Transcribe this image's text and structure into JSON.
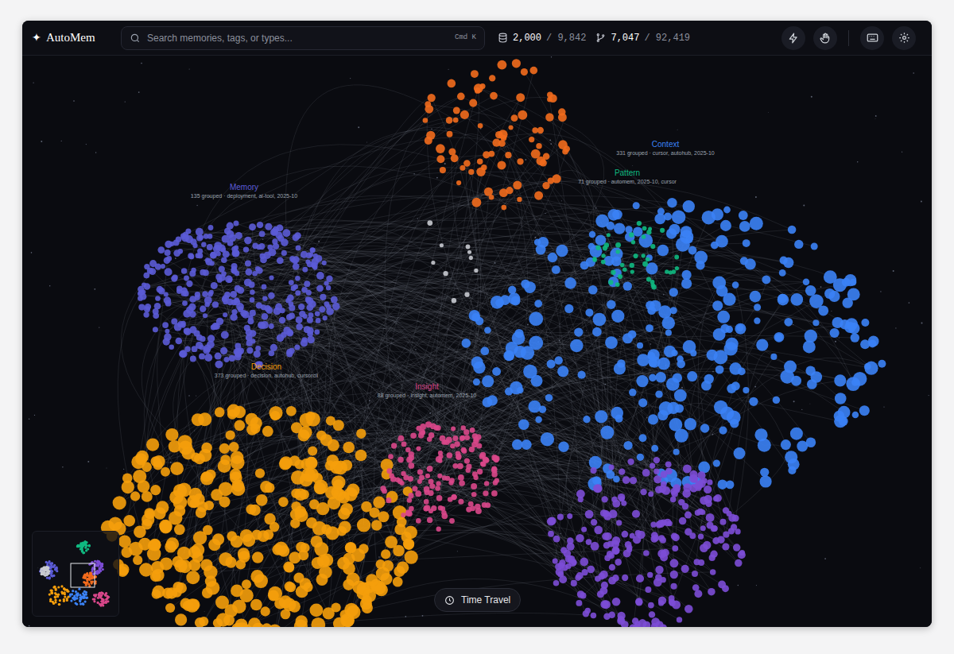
{
  "app": {
    "logo_icon": "✦",
    "name": "AutoMem"
  },
  "search": {
    "placeholder": "Search memories, tags, or types...",
    "shortcut": "Cmd K"
  },
  "stats": [
    {
      "value": "2,000",
      "total": "/ 9,842"
    },
    {
      "value": "7,047",
      "total": "/ 92,419"
    }
  ],
  "clusters": [
    {
      "color": "#f26b1d"
    },
    {
      "color": "#5b5bd6",
      "label": "Memory",
      "detail": "135 grouped · deployment, ai-tool, 2025-10"
    },
    {
      "color": "#3b82f6",
      "label": "Context",
      "detail": "331 grouped · cursor, autohub, 2025-10"
    },
    {
      "color": "#10b981",
      "label": "Pattern",
      "detail": "71 grouped · automem, 2025-10, cursor"
    },
    {
      "color": "#f59e0b",
      "label": "Decision",
      "detail": "373 grouped · decision, autohub, cursorcli"
    },
    {
      "color": "#d9478a",
      "label": "Insight",
      "detail": "88 grouped · insight, automem, 2025-10"
    },
    {
      "color": "#7c4dd6"
    },
    {
      "color": "#c8cad0"
    }
  ],
  "time_travel": {
    "label": "Time Travel"
  }
}
